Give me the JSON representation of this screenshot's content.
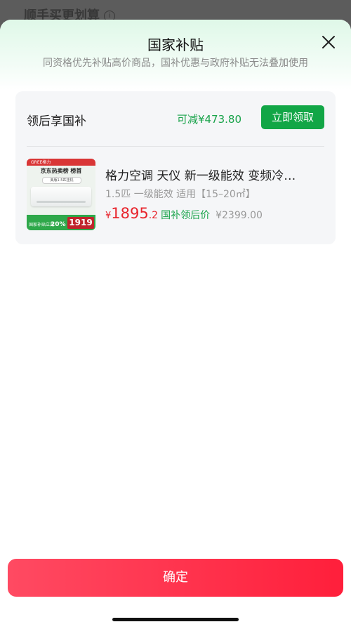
{
  "backdrop": {
    "text": "顺手买更划算",
    "info_icon": "info-icon"
  },
  "sheet": {
    "title": "国家补贴",
    "subtitle": "同资格优先补贴高价商品，国补优惠与政府补贴无法叠加使用",
    "close_icon": "close-icon"
  },
  "subsidy": {
    "title": "领后享国补",
    "saving": "可减¥473.80",
    "claim_button": "立即领取"
  },
  "product": {
    "image": {
      "brand_ribbon": "GREE格力",
      "headline": "京东热卖榜  榜首",
      "sub": "美版1.5匹挂机",
      "bottom_text": "国家补贴立减",
      "discount": "20%",
      "price": "1919"
    },
    "name": "格力空调 天仪 新一级能效 变频冷…",
    "spec": "1.5匹  一级能效  适用【15–20㎡】",
    "currency": "¥",
    "price_int": "1895",
    "price_dec": ".2",
    "after_label": "国补领后价",
    "original_price": "¥2399.00"
  },
  "footer": {
    "confirm_button": "确定"
  },
  "colors": {
    "accent_green": "#12a646",
    "price_red": "#e8242c",
    "confirm_red": "#ff1f3b"
  }
}
